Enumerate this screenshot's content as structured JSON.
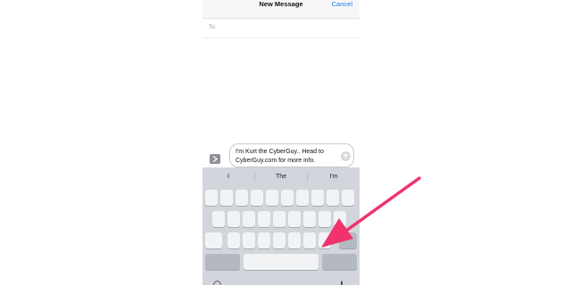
{
  "header": {
    "title": "New Message",
    "cancel_label": "Cancel"
  },
  "recipient": {
    "label": "To:",
    "value": ""
  },
  "composer": {
    "message_text": "I'm Kurt the CyberGuy.. Head to CyberGuy.com for more info."
  },
  "keyboard": {
    "predictions": [
      "I",
      "The",
      "I'm"
    ]
  },
  "colors": {
    "accent": "#1b7bf6",
    "annotation_arrow": "#f0336c",
    "keyboard_bg": "#d2d5db"
  },
  "icons": {
    "expand": "chevron-right-icon",
    "send": "arrow-up-icon",
    "emoji": "emoji-icon",
    "dictation": "microphone-icon"
  }
}
